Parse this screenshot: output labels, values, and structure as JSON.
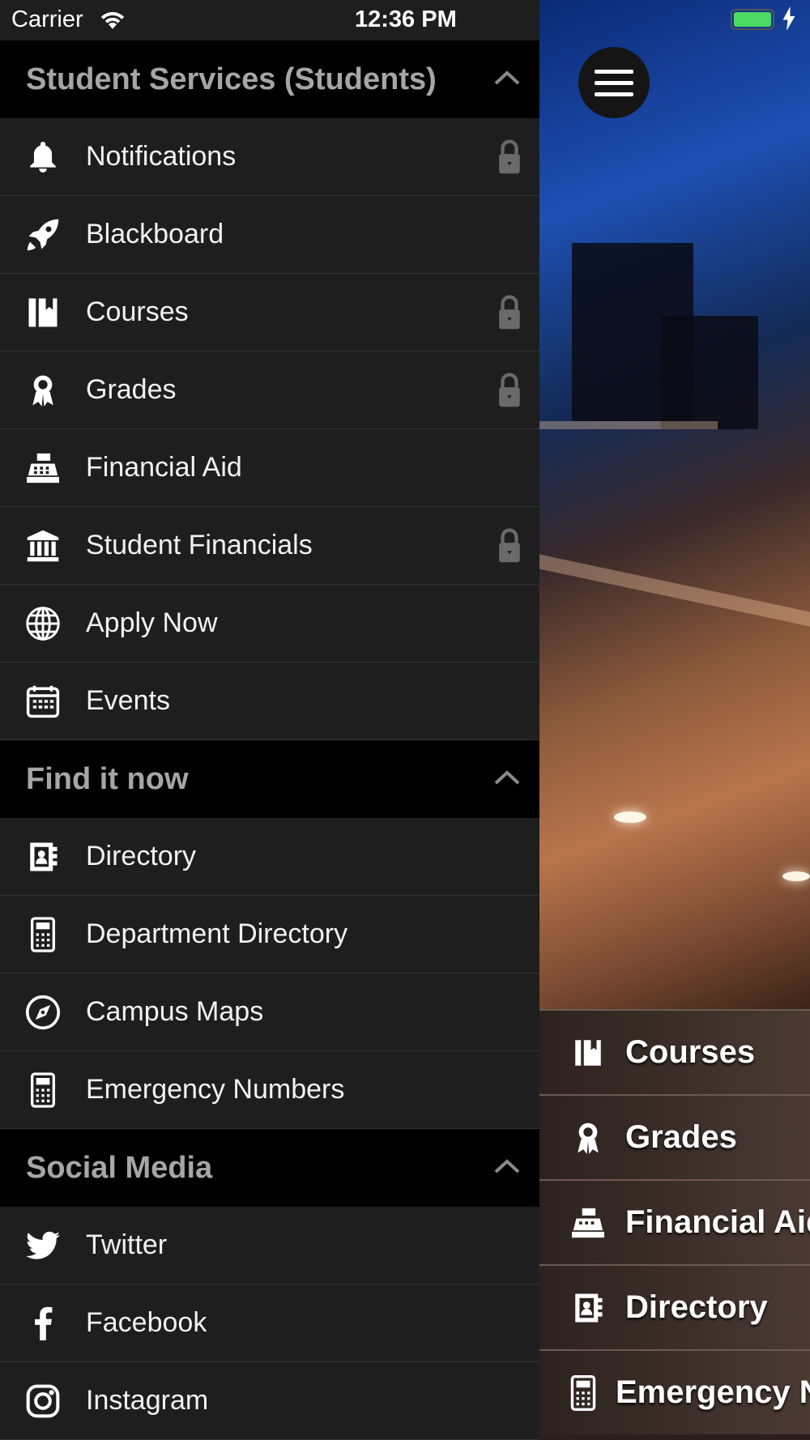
{
  "status_bar": {
    "carrier": "Carrier",
    "time": "12:36 PM"
  },
  "drawer": {
    "sections": [
      {
        "title": "Student Services (Students)",
        "items": [
          {
            "label": "Notifications",
            "icon": "bell-icon",
            "locked": true
          },
          {
            "label": "Blackboard",
            "icon": "rocket-icon",
            "locked": false
          },
          {
            "label": "Courses",
            "icon": "book-icon",
            "locked": true
          },
          {
            "label": "Grades",
            "icon": "award-icon",
            "locked": true
          },
          {
            "label": "Financial Aid",
            "icon": "cash-register-icon",
            "locked": false
          },
          {
            "label": "Student Financials",
            "icon": "bank-icon",
            "locked": true
          },
          {
            "label": "Apply Now",
            "icon": "globe-icon",
            "locked": false
          },
          {
            "label": "Events",
            "icon": "calendar-icon",
            "locked": false
          }
        ]
      },
      {
        "title": "Find it now",
        "items": [
          {
            "label": "Directory",
            "icon": "address-book-icon",
            "locked": false
          },
          {
            "label": "Department Directory",
            "icon": "calculator-icon",
            "locked": false
          },
          {
            "label": "Campus Maps",
            "icon": "compass-icon",
            "locked": false
          },
          {
            "label": "Emergency Numbers",
            "icon": "calculator-icon",
            "locked": false
          }
        ]
      },
      {
        "title": "Social Media",
        "items": [
          {
            "label": "Twitter",
            "icon": "twitter-icon",
            "locked": false
          },
          {
            "label": "Facebook",
            "icon": "facebook-icon",
            "locked": false
          },
          {
            "label": "Instagram",
            "icon": "instagram-icon",
            "locked": false
          }
        ]
      }
    ]
  },
  "quick_links": [
    {
      "label": "Courses",
      "icon": "book-icon"
    },
    {
      "label": "Grades",
      "icon": "award-icon"
    },
    {
      "label": "Financial Aid",
      "icon": "cash-register-icon"
    },
    {
      "label": "Directory",
      "icon": "address-book-icon"
    },
    {
      "label": "Emergency Numbers",
      "icon": "calculator-icon"
    }
  ],
  "colors": {
    "drawer_bg": "#1e1e1f",
    "section_header_bg": "#000000",
    "section_title": "#a6a6a6",
    "battery": "#4cd964"
  }
}
